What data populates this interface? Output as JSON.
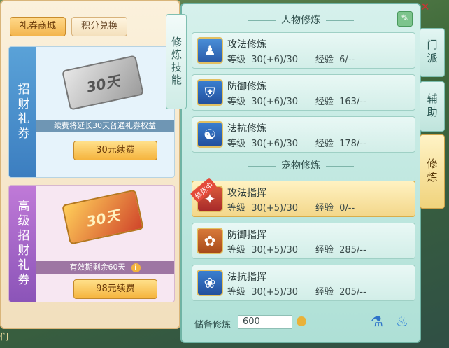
{
  "shop": {
    "tabs": [
      "礼券商城",
      "积分兑换"
    ],
    "card1": {
      "side_label": "招财礼券",
      "ticket_text": "30天",
      "note": "续费将延长30天普通礼券权益",
      "button": "30元续费"
    },
    "card2": {
      "side_label": "高级招财礼券",
      "ticket_text": "30天",
      "note": "有效期剩余60天",
      "button": "98元续费"
    }
  },
  "panel": {
    "vertical_tab": "修炼技能",
    "character_section": "人物修炼",
    "pet_section": "宠物修炼",
    "training_badge": "修炼中",
    "skills": [
      {
        "name": "攻法修炼",
        "level": "等级  30(+6)/30",
        "exp": "经验  6/--"
      },
      {
        "name": "防御修炼",
        "level": "等级  30(+6)/30",
        "exp": "经验  163/--"
      },
      {
        "name": "法抗修炼",
        "level": "等级  30(+6)/30",
        "exp": "经验  178/--"
      },
      {
        "name": "攻法指挥",
        "level": "等级  30(+5)/30",
        "exp": "经验  0/--"
      },
      {
        "name": "防御指挥",
        "level": "等级  30(+5)/30",
        "exp": "经验  285/--"
      },
      {
        "name": "法抗指挥",
        "level": "等级  30(+5)/30",
        "exp": "经验  205/--"
      }
    ],
    "reserve_label": "储备修炼",
    "reserve_value": "600"
  },
  "side_tabs": [
    "门派",
    "辅助",
    "修炼"
  ],
  "bottom_text": "们",
  "colors": {
    "active_tab": "#f0d37c",
    "panel_bg": "#aee0d6"
  }
}
